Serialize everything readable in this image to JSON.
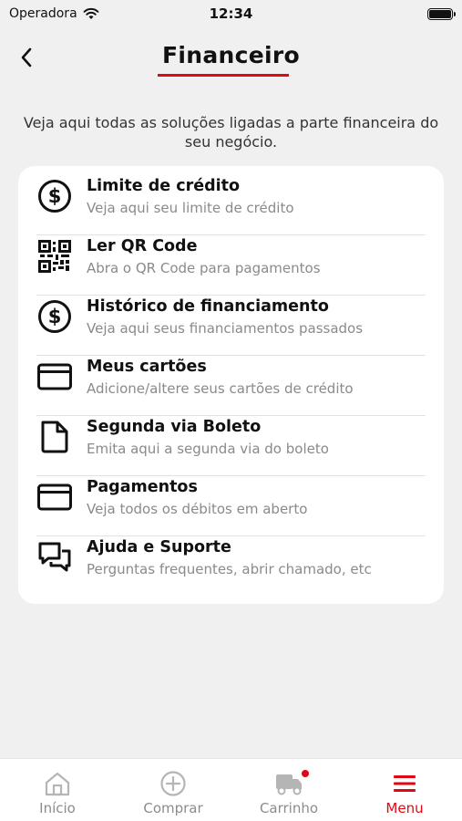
{
  "status_bar": {
    "carrier": "Operadora",
    "time": "12:34"
  },
  "header": {
    "title": "Financeiro"
  },
  "intro": "Veja aqui todas as soluções ligadas a parte financeira do seu negócio.",
  "menu": [
    {
      "title": "Limite de crédito",
      "subtitle": "Veja aqui seu limite de crédito",
      "icon": "dollar-circle-icon"
    },
    {
      "title": "Ler QR Code",
      "subtitle": "Abra o QR Code para pagamentos",
      "icon": "qr-code-icon"
    },
    {
      "title": "Histórico de financiamento",
      "subtitle": "Veja aqui seus financiamentos passados",
      "icon": "dollar-circle-icon"
    },
    {
      "title": "Meus cartões",
      "subtitle": "Adicione/altere seus cartões de crédito",
      "icon": "credit-card-icon"
    },
    {
      "title": "Segunda via Boleto",
      "subtitle": "Emita aqui a segunda via do boleto",
      "icon": "document-icon"
    },
    {
      "title": "Pagamentos",
      "subtitle": "Veja todos os débitos em aberto",
      "icon": "credit-card-icon"
    },
    {
      "title": "Ajuda e Suporte",
      "subtitle": "Perguntas frequentes, abrir chamado, etc",
      "icon": "chat-bubbles-icon"
    }
  ],
  "tab_bar": {
    "tabs": [
      {
        "label": "Início",
        "icon": "home-icon"
      },
      {
        "label": "Comprar",
        "icon": "plus-circle-icon"
      },
      {
        "label": "Carrinho",
        "icon": "truck-icon",
        "badge": true
      },
      {
        "label": "Menu",
        "icon": "hamburger-menu-icon",
        "active": true
      }
    ]
  },
  "colors": {
    "accent": "#e30613",
    "background": "#f0f0f0",
    "inactive_tab": "#8c8c8c"
  }
}
